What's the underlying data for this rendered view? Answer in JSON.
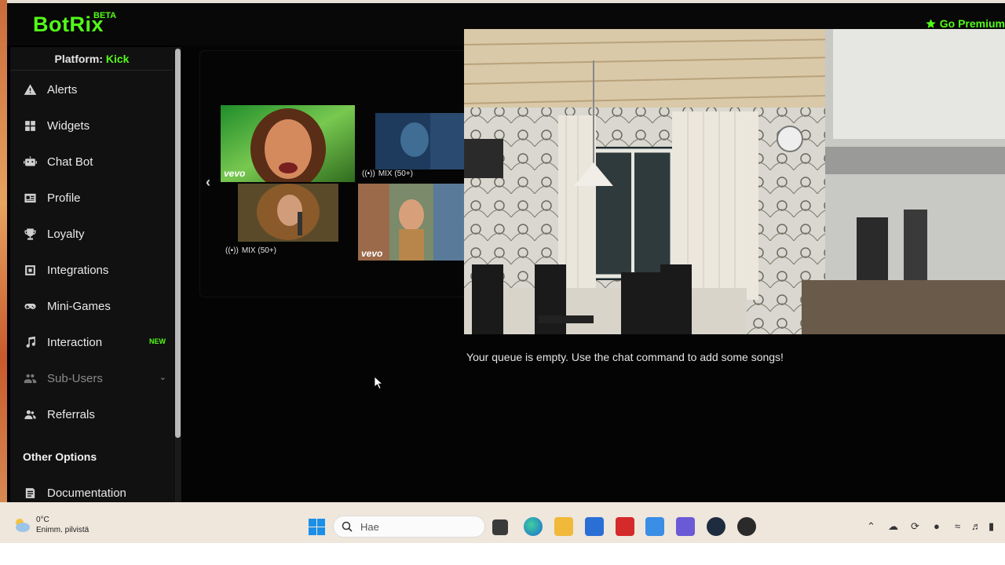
{
  "app": {
    "logo": "BotRix",
    "logo_badge": "BETA",
    "premium_label": "Go Premium"
  },
  "sidebar": {
    "platform_label": "Platform:",
    "platform_value": "Kick",
    "items": [
      {
        "label": "Alerts",
        "icon": "warning-icon"
      },
      {
        "label": "Widgets",
        "icon": "grid-icon"
      },
      {
        "label": "Chat Bot",
        "icon": "robot-icon"
      },
      {
        "label": "Profile",
        "icon": "id-card-icon"
      },
      {
        "label": "Loyalty",
        "icon": "trophy-icon"
      },
      {
        "label": "Integrations",
        "icon": "plug-icon"
      },
      {
        "label": "Mini-Games",
        "icon": "gamepad-icon"
      },
      {
        "label": "Interaction",
        "icon": "music-icon",
        "badge": "NEW"
      },
      {
        "label": "Sub-Users",
        "icon": "users-icon"
      },
      {
        "label": "Referrals",
        "icon": "user-group-icon"
      }
    ],
    "other_options_title": "Other Options",
    "other_items": [
      {
        "label": "Documentation",
        "icon": "document-icon"
      }
    ]
  },
  "player": {
    "thumbs": [
      {
        "label": "",
        "brand": "vevo"
      },
      {
        "label": "MIX (50+)",
        "brand": ""
      },
      {
        "label": "MIX (50+)",
        "brand": ""
      },
      {
        "label": "",
        "brand": "vevo"
      }
    ]
  },
  "queue": {
    "empty_message": "Your queue is empty. Use the chat command to add some songs!"
  },
  "taskbar": {
    "weather_temp": "0°C",
    "weather_desc": "Enimm. pilvistä",
    "search_placeholder": "Hae"
  },
  "colors": {
    "accent": "#53fc18",
    "background": "#000000",
    "sidebar": "#111111"
  }
}
